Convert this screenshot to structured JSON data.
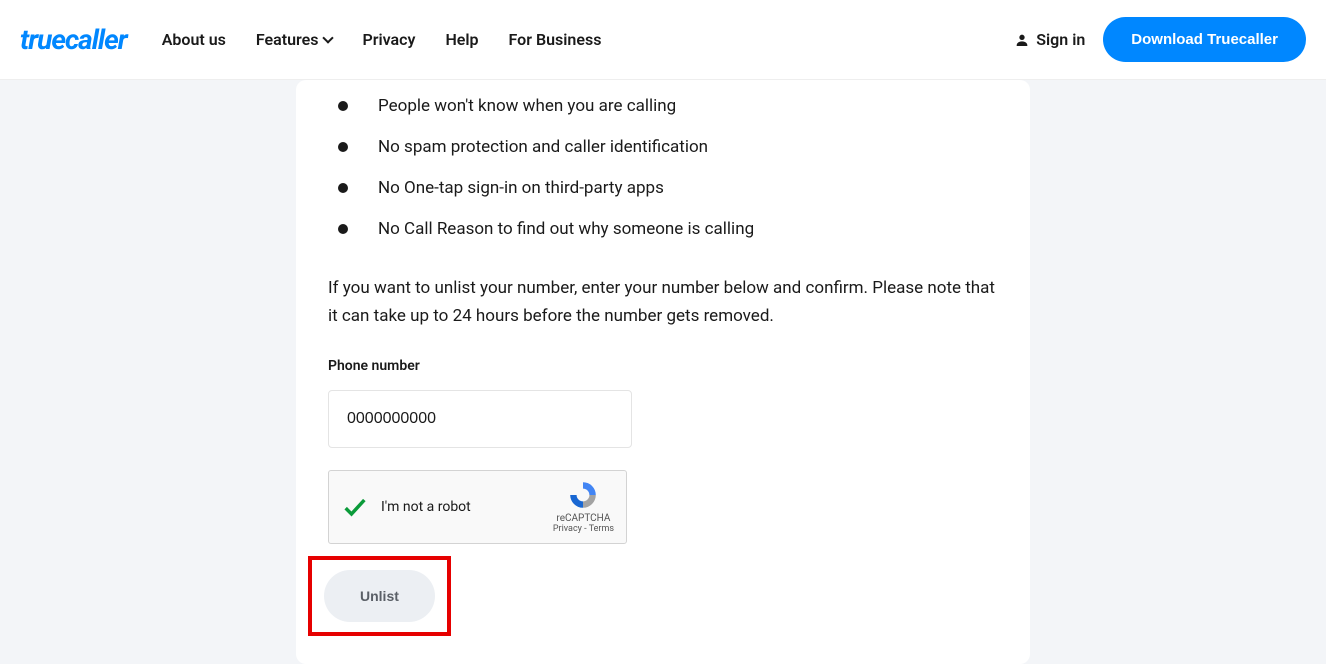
{
  "header": {
    "logo": "truecaller",
    "nav": [
      {
        "label": "About us"
      },
      {
        "label": "Features",
        "has_dropdown": true
      },
      {
        "label": "Privacy"
      },
      {
        "label": "Help"
      },
      {
        "label": "For Business"
      }
    ],
    "signin": "Sign in",
    "download": "Download Truecaller"
  },
  "main": {
    "bullets": [
      "People won't know when you are calling",
      "No spam protection and caller identification",
      "No One-tap sign-in on third-party apps",
      "No Call Reason to find out why someone is calling"
    ],
    "description": "If you want to unlist your number, enter your number below and confirm. Please note that it can take up to 24 hours before the number gets removed.",
    "phone_label": "Phone number",
    "phone_value": "0000000000",
    "recaptcha": {
      "text": "I'm not a robot",
      "brand": "reCAPTCHA",
      "links": "Privacy - Terms"
    },
    "unlist_label": "Unlist"
  }
}
